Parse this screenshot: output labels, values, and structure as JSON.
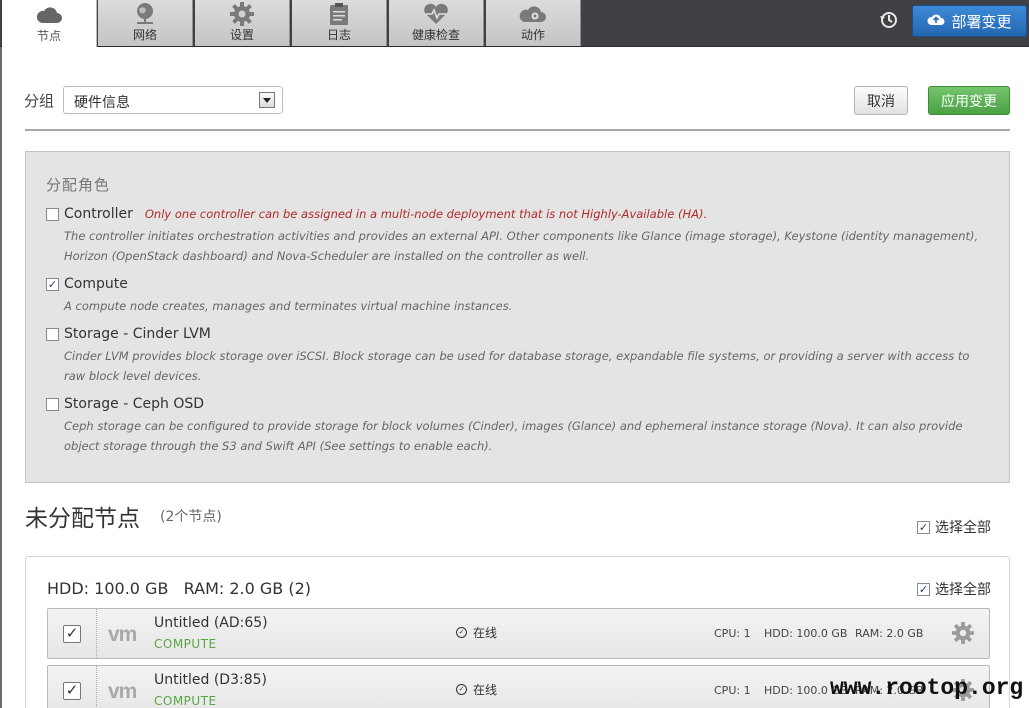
{
  "tabs": [
    {
      "label": "节点",
      "icon": "cloud-icon",
      "active": true
    },
    {
      "label": "网络",
      "icon": "network-globe-icon",
      "active": false
    },
    {
      "label": "设置",
      "icon": "gear-icon",
      "active": false
    },
    {
      "label": "日志",
      "icon": "clipboard-icon",
      "active": false
    },
    {
      "label": "健康检查",
      "icon": "heart-pulse-icon",
      "active": false
    },
    {
      "label": "动作",
      "icon": "cloud-gear-icon",
      "active": false
    }
  ],
  "header": {
    "history_icon": "history-icon",
    "deploy_label": "部署变更",
    "deploy_icon": "cloud-upload-icon",
    "deploy_color": "#2b72c2"
  },
  "toolbar": {
    "group_label": "分组",
    "group_value": "硬件信息",
    "cancel_label": "取消",
    "apply_label": "应用变更",
    "apply_color": "#5cb452"
  },
  "roles": {
    "title": "分配角色",
    "items": [
      {
        "name": "Controller",
        "checked": false,
        "warning": "Only one controller can be assigned in a multi-node deployment that is not Highly-Available (HA).",
        "desc": "The controller initiates orchestration activities and provides an external API. Other components like Glance (image storage), Keystone (identity management), Horizon (OpenStack dashboard) and Nova-Scheduler are installed on the controller as well."
      },
      {
        "name": "Compute",
        "checked": true,
        "warning": "",
        "desc": "A compute node creates, manages and terminates virtual machine instances."
      },
      {
        "name": "Storage - Cinder LVM",
        "checked": false,
        "warning": "",
        "desc": "Cinder LVM provides block storage over iSCSI. Block storage can be used for database storage, expandable file systems, or providing a server with access to raw block level devices."
      },
      {
        "name": "Storage - Ceph OSD",
        "checked": false,
        "warning": "",
        "desc": "Ceph storage can be configured to provide storage for block volumes (Cinder), images (Glance) and ephemeral instance storage (Nova). It can also provide object storage through the S3 and Swift API (See settings to enable each)."
      }
    ]
  },
  "unallocated": {
    "title": "未分配节点",
    "count": "(2个节点)",
    "select_all_label": "选择全部",
    "group": {
      "title": "HDD: 100.0 GB   RAM: 2.0 GB (2)",
      "select_all_label": "选择全部",
      "nodes": [
        {
          "name": "Untitled (AD:65)",
          "role": "COMPUTE",
          "status": "在线",
          "cpu": "CPU: 1",
          "hdd": "HDD: 100.0 GB",
          "ram": "RAM: 2.0 GB",
          "logo": "vm"
        },
        {
          "name": "Untitled (D3:85)",
          "role": "COMPUTE",
          "status": "在线",
          "cpu": "CPU: 1",
          "hdd": "HDD: 100.0 GB",
          "ram": "RAM: 2.0 GB",
          "logo": "vm"
        }
      ]
    }
  },
  "watermark": "www.rootop.org"
}
